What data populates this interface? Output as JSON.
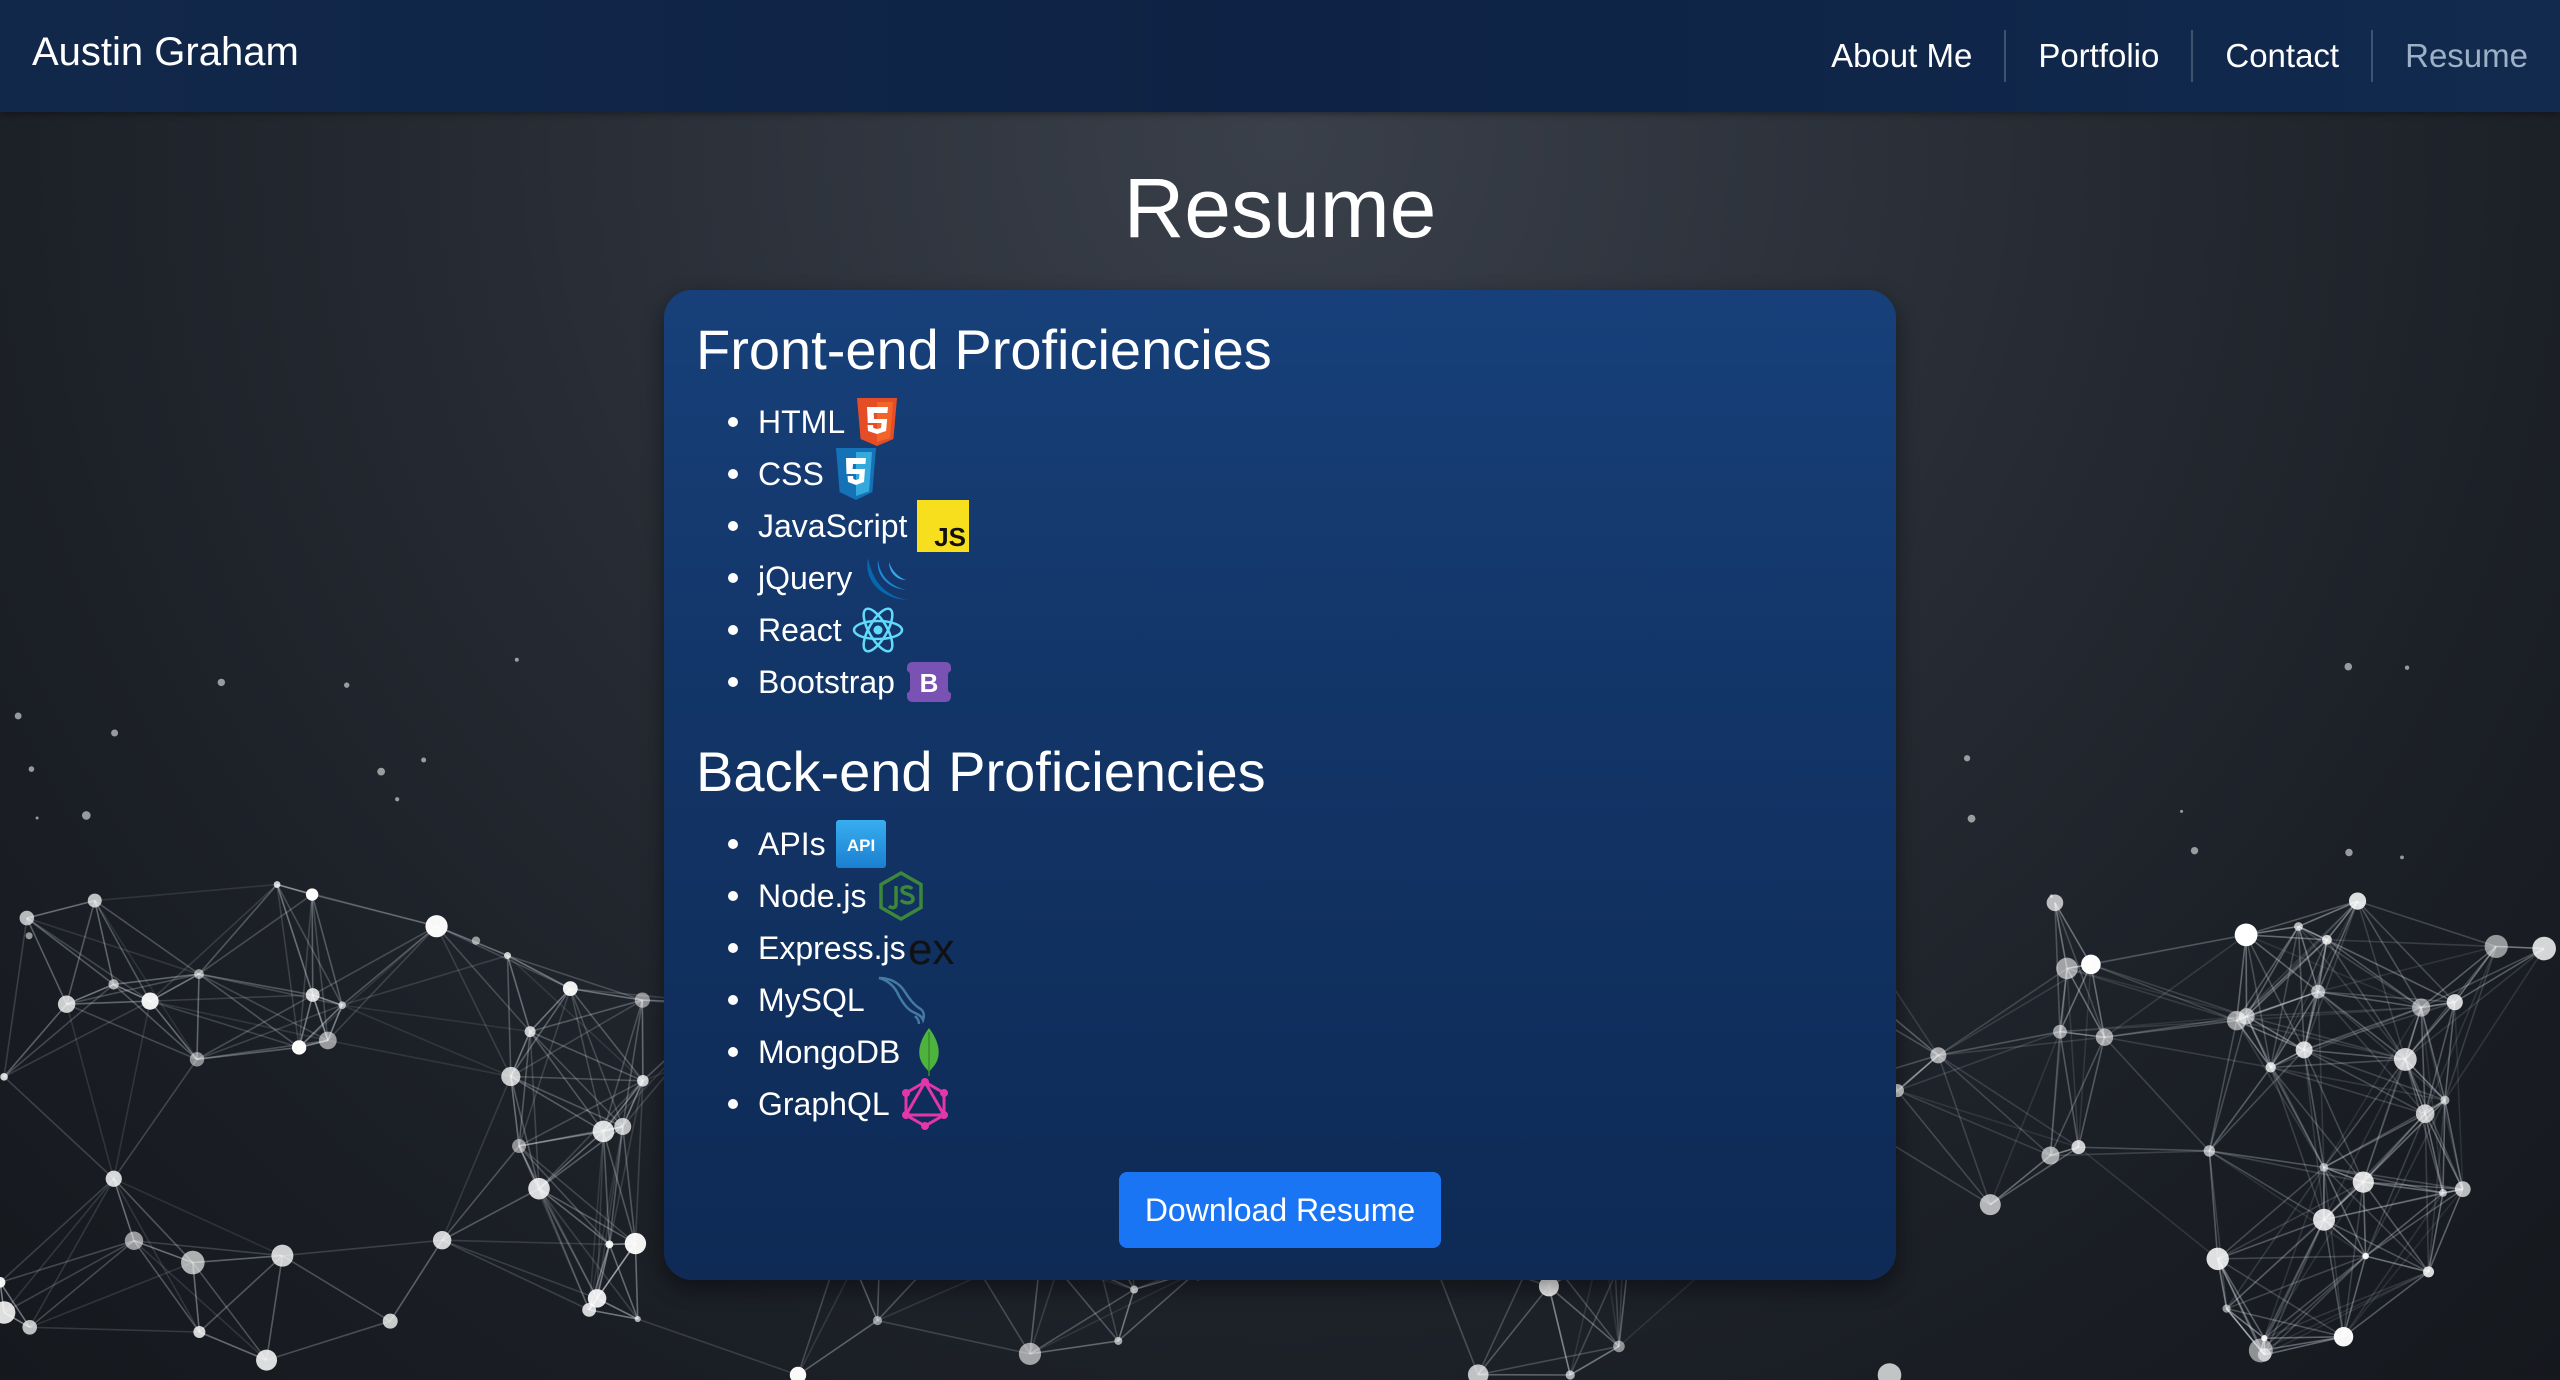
{
  "nav": {
    "brand": "Austin Graham",
    "links": [
      {
        "label": "About Me"
      },
      {
        "label": "Portfolio"
      },
      {
        "label": "Contact"
      },
      {
        "label": "Resume",
        "active": true
      }
    ]
  },
  "page": {
    "title": "Resume"
  },
  "frontend": {
    "heading": "Front-end Proficiencies",
    "items": [
      {
        "label": "HTML",
        "icon": "html5-icon"
      },
      {
        "label": "CSS",
        "icon": "css3-icon"
      },
      {
        "label": "JavaScript",
        "icon": "javascript-icon"
      },
      {
        "label": "jQuery",
        "icon": "jquery-icon"
      },
      {
        "label": "React",
        "icon": "react-icon"
      },
      {
        "label": "Bootstrap",
        "icon": "bootstrap-icon"
      }
    ]
  },
  "backend": {
    "heading": "Back-end Proficiencies",
    "items": [
      {
        "label": "APIs",
        "icon": "api-icon"
      },
      {
        "label": "Node.js",
        "icon": "nodejs-icon"
      },
      {
        "label": "Express.js",
        "icon": "express-icon"
      },
      {
        "label": "MySQL",
        "icon": "mysql-icon"
      },
      {
        "label": "MongoDB",
        "icon": "mongodb-icon"
      },
      {
        "label": "GraphQL",
        "icon": "graphql-icon"
      }
    ]
  },
  "icon_text": {
    "js": "JS",
    "bootstrap": "B",
    "api": "API",
    "express": "ex"
  },
  "download": {
    "label": "Download Resume"
  },
  "colors": {
    "navbar": "#0f2447",
    "card": "#123466",
    "button": "#1a75f5",
    "active_link": "#9db0c6",
    "html5": "#e44d26",
    "css3": "#1572b6",
    "javascript": "#f7df1e",
    "jquery": "#0769ad",
    "react": "#61dafb",
    "bootstrap": "#7952b3",
    "api": "#2e9be6",
    "nodejs": "#3c873a",
    "mysql": "#4479a1",
    "mongodb": "#4db33d",
    "graphql": "#e535ab"
  }
}
